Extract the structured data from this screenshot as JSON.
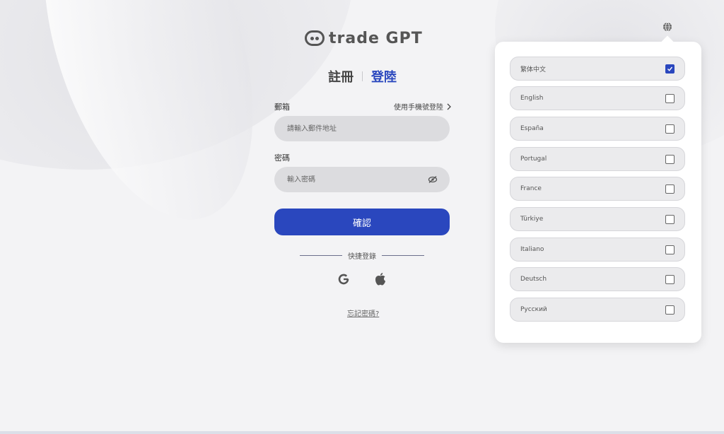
{
  "logo": {
    "text": "trade GPT"
  },
  "tabs": [
    {
      "label": "註冊",
      "active": false
    },
    {
      "label": "登陸",
      "active": true
    }
  ],
  "form": {
    "email_label": "郵箱",
    "phone_login_link": "使用手機號登陸",
    "email_placeholder": "請輸入郵件地址",
    "password_label": "密碼",
    "password_placeholder": "輸入密碼",
    "confirm_label": "確認",
    "quick_login_label": "快捷登錄",
    "forgot_password": "忘記密碼?"
  },
  "social": [
    "google-icon",
    "apple-icon"
  ],
  "languages": [
    {
      "label": "繁体中文",
      "checked": true
    },
    {
      "label": "English",
      "checked": false
    },
    {
      "label": "España",
      "checked": false
    },
    {
      "label": "Portugal",
      "checked": false
    },
    {
      "label": "France",
      "checked": false
    },
    {
      "label": "Türkiye",
      "checked": false
    },
    {
      "label": "Italiano",
      "checked": false
    },
    {
      "label": "Deutsch",
      "checked": false
    },
    {
      "label": "Русский",
      "checked": false
    }
  ],
  "colors": {
    "accent": "#2a47be",
    "input_bg": "#dcdcdf",
    "background": "#f3f3f5"
  }
}
